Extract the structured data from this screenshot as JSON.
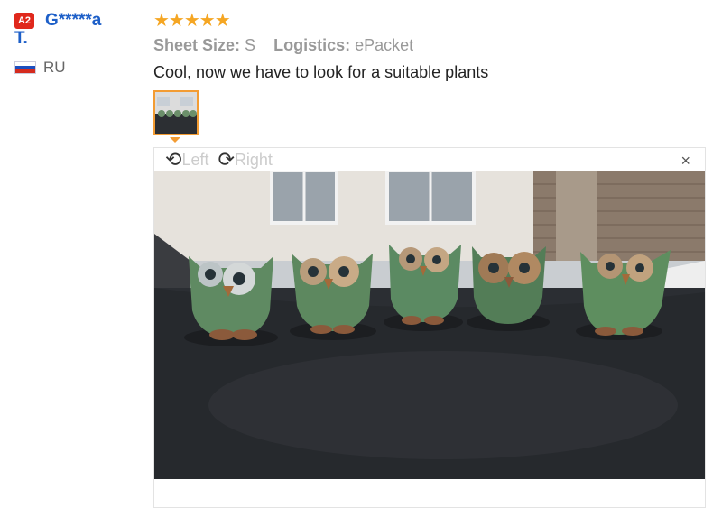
{
  "reviewer": {
    "level": "A2",
    "name_line1": "G*****a",
    "name_line2": "T.",
    "country": "RU",
    "flag_colors": [
      "#ffffff",
      "#1c4fbf",
      "#d52b1e"
    ]
  },
  "review": {
    "rating": 5,
    "stars": "★★★★★",
    "sheet_size_label": "Sheet Size:",
    "sheet_size_value": "S",
    "logistics_label": "Logistics:",
    "logistics_value": "ePacket",
    "text": "Cool, now we have to look for a suitable plants"
  },
  "viewer": {
    "rotate_left_label": "Left",
    "rotate_right_label": "Right",
    "close_symbol": "×"
  },
  "colors": {
    "accent": "#f39c33",
    "name": "#1d5fc8",
    "badge": "#e0281c",
    "star": "#f5a623"
  }
}
